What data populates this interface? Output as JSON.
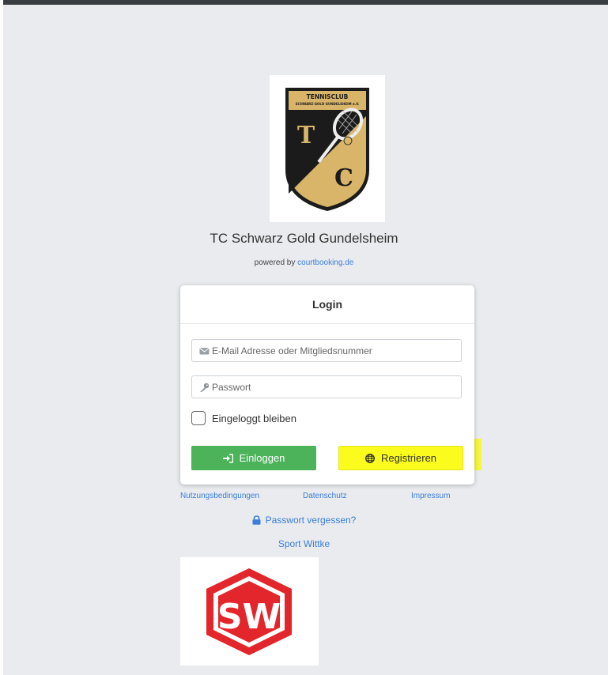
{
  "club": {
    "logo_top_text": "TENNISCLUB",
    "logo_sub_text": "SCHWARZ-GOLD GUNDELSHEIM e.V.",
    "logo_letter_1": "T",
    "logo_letter_2": "C",
    "title": "TC Schwarz Gold Gundelsheim"
  },
  "powered": {
    "prefix": "powered by",
    "link": "courtbooking.de"
  },
  "login": {
    "header": "Login",
    "email_placeholder": "E-Mail Adresse oder Mitgliedsnummer",
    "password_placeholder": "Passwort",
    "remember_label": "Eingeloggt bleiben",
    "login_button": "Einloggen",
    "register_button": "Registrieren"
  },
  "footer": {
    "terms": "Nutzungsbedingungen",
    "privacy": "Datenschutz",
    "imprint": "Impressum",
    "forgot": "Passwort vergessen?",
    "sponsor": "Sport Wittke",
    "sponsor_logo_text": "SW"
  },
  "icons": {
    "email": "envelope-icon",
    "password": "key-icon",
    "login": "sign-in-icon",
    "register": "globe-icon",
    "forgot": "lock-icon"
  },
  "colors": {
    "primary_green": "#4cb35b",
    "link_blue": "#3b7dd8",
    "highlight_yellow": "#fbfb1e",
    "sponsor_red": "#e3262b",
    "logo_gold": "#d9b56a"
  }
}
